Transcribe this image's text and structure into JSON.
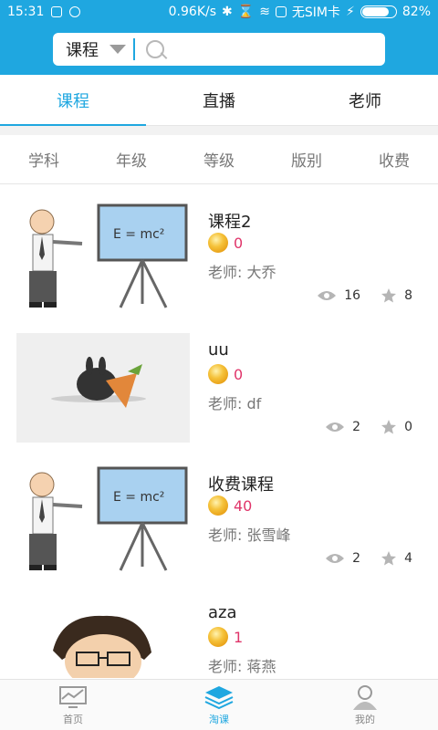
{
  "status_bar": {
    "time": "15:31",
    "speed": "0.96K/s",
    "sim": "无SIM卡",
    "battery": "82%",
    "battery_level": 0.82
  },
  "search": {
    "category": "课程",
    "placeholder": ""
  },
  "tabs": [
    {
      "label": "课程",
      "active": true
    },
    {
      "label": "直播",
      "active": false
    },
    {
      "label": "老师",
      "active": false
    }
  ],
  "filters": [
    "学科",
    "年级",
    "等级",
    "版别",
    "收费"
  ],
  "courses": [
    {
      "title": "课程2",
      "price": "0",
      "teacher": "老师: 大乔",
      "views": "16",
      "stars": "8"
    },
    {
      "title": "uu",
      "price": "0",
      "teacher": "老师: df",
      "views": "2",
      "stars": "0"
    },
    {
      "title": "收费课程",
      "price": "40",
      "teacher": "老师: 张雪峰",
      "views": "2",
      "stars": "4"
    },
    {
      "title": "aza",
      "price": "1",
      "teacher": "老师: 蒋燕",
      "views": "",
      "stars": ""
    }
  ],
  "bottom_nav": [
    {
      "label": "首页",
      "icon": "home-icon",
      "active": false
    },
    {
      "label": "淘课",
      "icon": "layers-icon",
      "active": true
    },
    {
      "label": "我的",
      "icon": "user-icon",
      "active": false
    }
  ],
  "colors": {
    "accent": "#1fa7e0",
    "price": "#e0356a"
  }
}
